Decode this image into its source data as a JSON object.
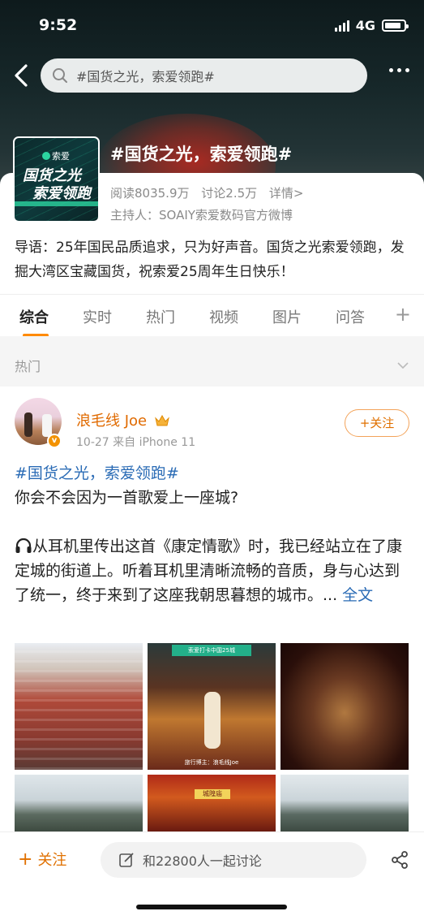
{
  "status_bar": {
    "time": "9:52",
    "network": "4G"
  },
  "header": {
    "search_text": "#国货之光，索爱领跑#"
  },
  "topic": {
    "cover_brand": "索爱",
    "cover_line1": "国货之光",
    "cover_line2": "索爱领跑",
    "title": "#国货之光，索爱领跑#",
    "reads": "阅读8035.9万",
    "discussions": "讨论2.5万",
    "details": "详情>",
    "host": "主持人：SOAIY索爱数码官方微博",
    "intro": "导语：25年国民品质追求，只为好声音。国货之光索爱领跑，发掘大湾区宝藏国货，祝索爱25周年生日快乐！"
  },
  "tabs": [
    "综合",
    "实时",
    "热门",
    "视频",
    "图片",
    "问答"
  ],
  "active_tab": "综合",
  "section": {
    "label": "热门"
  },
  "post": {
    "username": "浪毛线 Joe",
    "time_source": "10-27  来自 iPhone 11",
    "follow_label": "+关注",
    "tag": "#国货之光，索爱领跑#",
    "line1": "你会不会因为一首歌爱上一座城?",
    "body": "从耳机里传出这首《康定情歌》时，我已经站立在了康定城的街道上。听着耳机里清晰流畅的音质，身与心达到了统一，终于来到了这座我朝思暮想的城市。...",
    "more_link": "全文",
    "photo2_band": "索爱打卡中国25城",
    "photo2_caption": "旅行博主：浪毛线Joe",
    "photo5_sign": "城隍庙"
  },
  "bottom_bar": {
    "follow": "关注",
    "discuss": "和22800人一起讨论"
  },
  "colors": {
    "accent": "#ff8a00",
    "link": "#2a6bb5",
    "username": "#e06a00"
  }
}
